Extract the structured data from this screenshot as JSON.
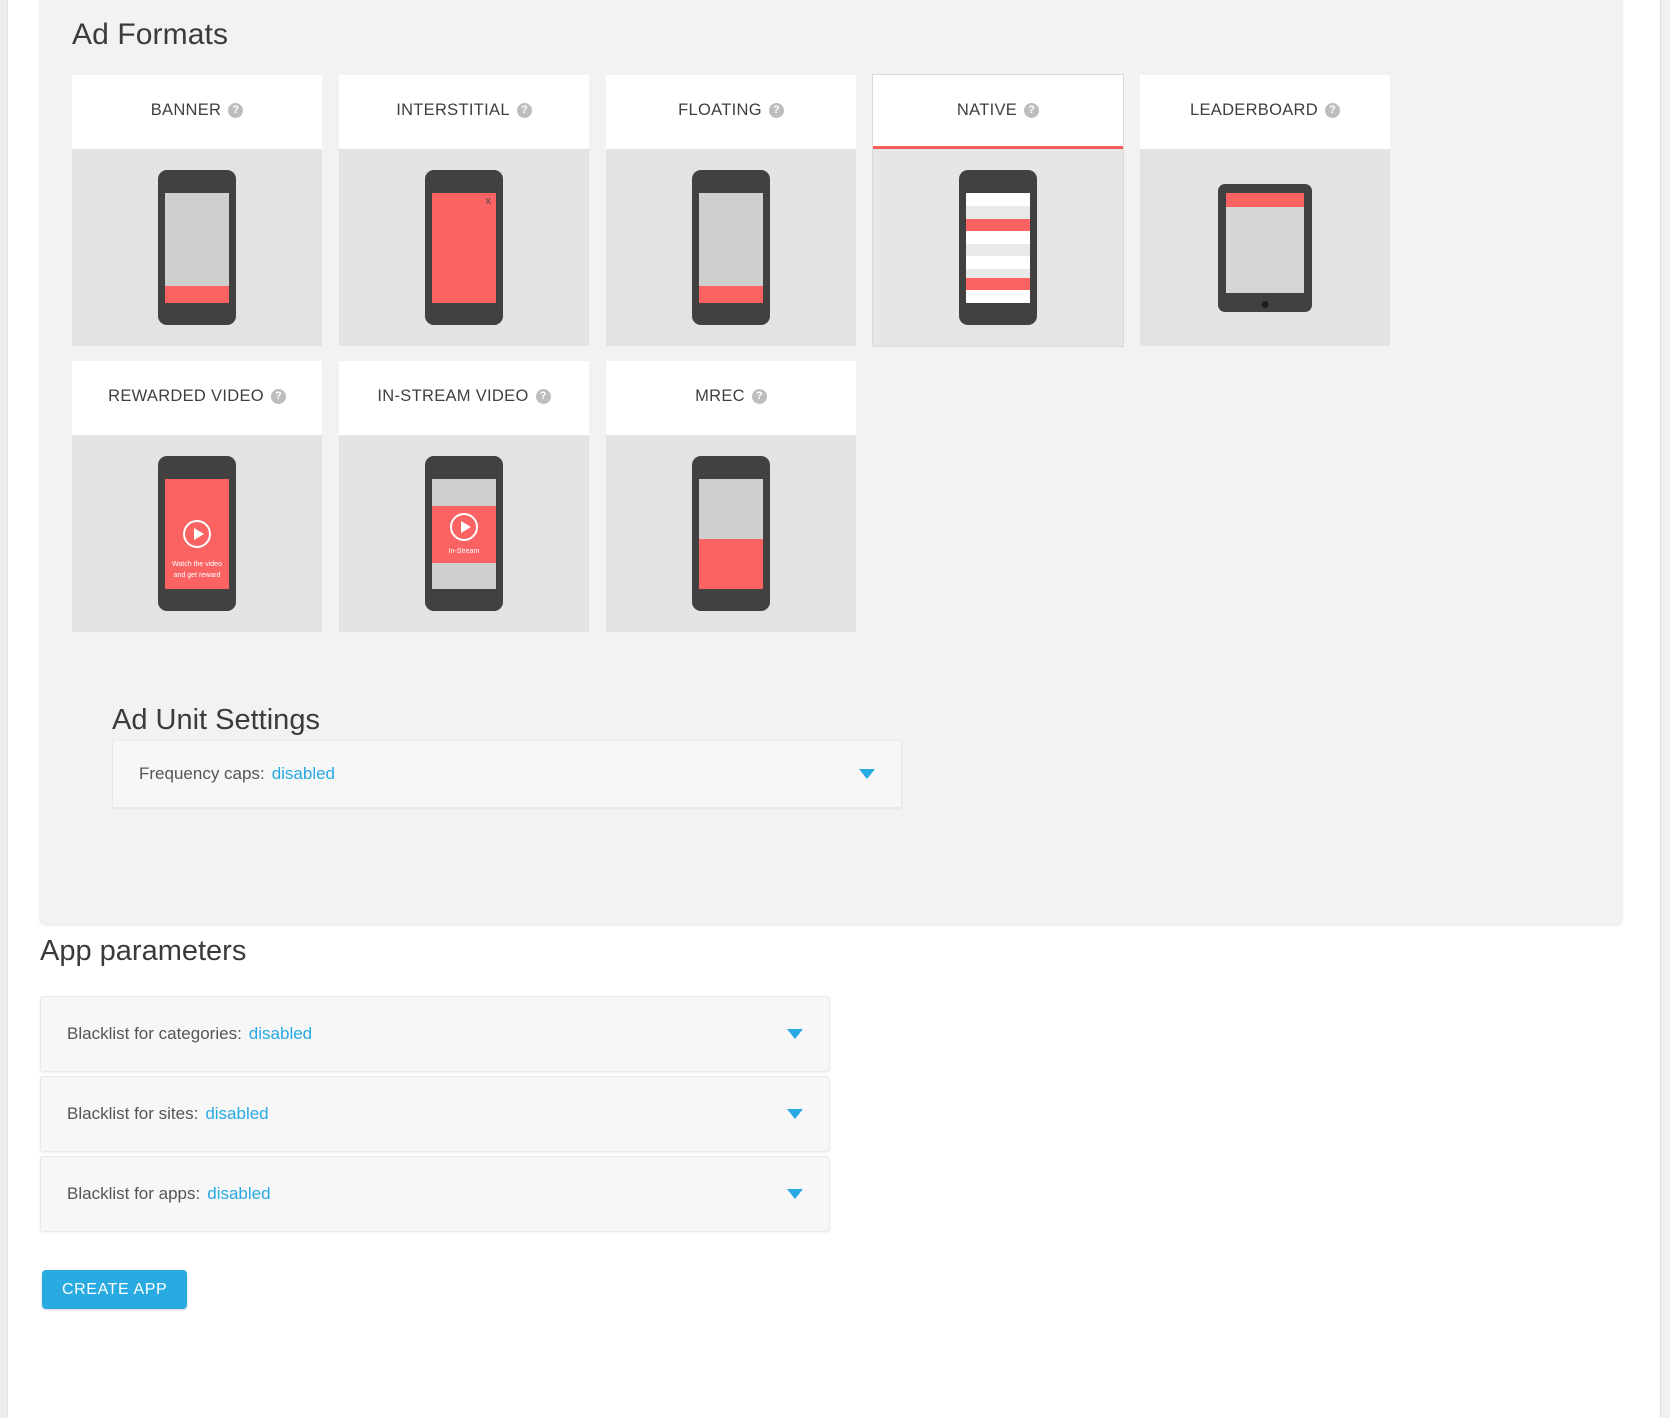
{
  "ad_formats": {
    "title": "Ad Formats",
    "help_icon": "help-circle-icon",
    "selected": "NATIVE",
    "accent_color": "#fb5d5d",
    "cards": [
      {
        "label": "BANNER",
        "mock": "banner"
      },
      {
        "label": "INTERSTITIAL",
        "mock": "interstitial"
      },
      {
        "label": "FLOATING",
        "mock": "floating"
      },
      {
        "label": "NATIVE",
        "mock": "native"
      },
      {
        "label": "LEADERBOARD",
        "mock": "leaderboard"
      },
      {
        "label": "REWARDED VIDEO",
        "mock": "rewarded-video"
      },
      {
        "label": "IN-STREAM VIDEO",
        "mock": "in-stream-video"
      },
      {
        "label": "MREC",
        "mock": "mrec"
      }
    ],
    "mock_text": {
      "interstitial_close": "x",
      "rewarded_line1": "Watch the video",
      "rewarded_line2": "and get reward",
      "instream_caption": "In-Stream"
    }
  },
  "ad_unit_settings": {
    "title": "Ad Unit Settings",
    "rows": [
      {
        "label": "Frequency caps:",
        "value": "disabled",
        "caret": "caret-down-icon"
      }
    ]
  },
  "app_parameters": {
    "title": "App parameters",
    "rows": [
      {
        "label": "Blacklist for categories:",
        "value": "disabled",
        "caret": "caret-down-icon"
      },
      {
        "label": "Blacklist for sites:",
        "value": "disabled",
        "caret": "caret-down-icon"
      },
      {
        "label": "Blacklist for apps:",
        "value": "disabled",
        "caret": "caret-down-icon"
      }
    ]
  },
  "actions": {
    "create_app_label": "CREATE APP",
    "create_app_color": "#29abe2"
  }
}
